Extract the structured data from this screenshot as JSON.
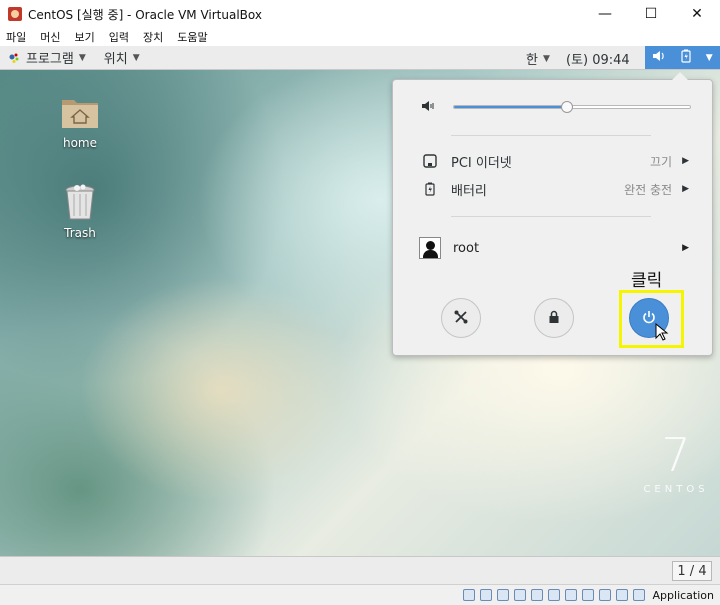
{
  "window": {
    "title": "CentOS [실행 중] - Oracle VM VirtualBox",
    "minimize": "—",
    "maximize": "☐",
    "close": "✕"
  },
  "vbox_menu": [
    "파일",
    "머신",
    "보기",
    "입력",
    "장치",
    "도움말"
  ],
  "gnome_bar": {
    "applications": "프로그램",
    "places": "위치",
    "input_method": "한",
    "clock": "(토) 09:44"
  },
  "desktop": {
    "icons": [
      {
        "label": "home",
        "icon": "home-folder-icon"
      },
      {
        "label": "Trash",
        "icon": "trash-icon"
      }
    ],
    "watermark": {
      "number": "7",
      "text": "CENTOS"
    }
  },
  "system_menu": {
    "volume_level": 0.48,
    "items": [
      {
        "label": "PCI 이더넷",
        "state": "끄기",
        "icon": "network-wired-icon"
      },
      {
        "label": "배터리",
        "state": "완전 충전",
        "icon": "battery-icon"
      }
    ],
    "user": {
      "name": "root",
      "icon": "user-avatar-icon"
    },
    "buttons": [
      {
        "name": "settings",
        "icon": "settings-tools-icon"
      },
      {
        "name": "lock",
        "icon": "lock-icon"
      },
      {
        "name": "power-off",
        "icon": "power-icon"
      }
    ],
    "annotation": "클릭",
    "accent_color": "#4a90d9",
    "highlight_color": "#f5f500"
  },
  "workspace": {
    "indicator": "1 / 4"
  },
  "vbox_status": {
    "host_key_label": "Application"
  }
}
